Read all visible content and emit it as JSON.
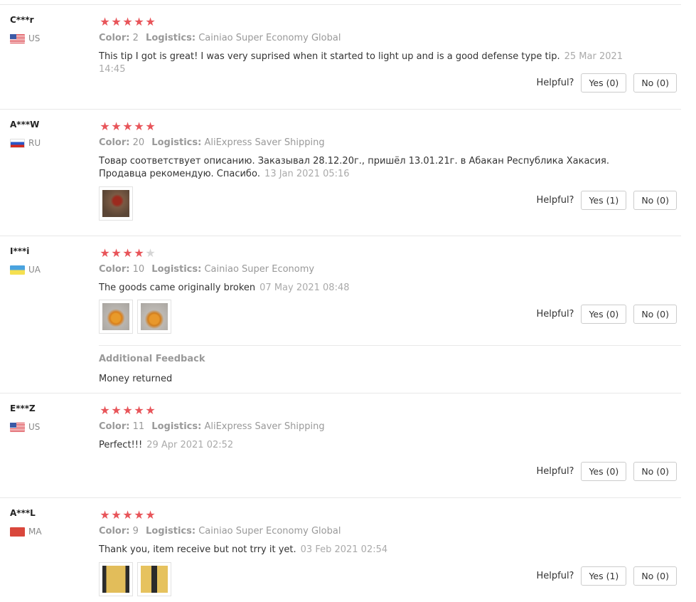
{
  "helpful_label": "Helpful?",
  "color_label": "Color:",
  "logistics_label": "Logistics:",
  "reviews": [
    {
      "user": "C***r",
      "country": "US",
      "stars": 5,
      "color": "2",
      "logistics": "Cainiao Super Economy Global",
      "text": "This tip I got is great! I was very suprised when it started to light up and is a good defense type tip.",
      "date": "25 Mar 2021 14:45",
      "yes": "Yes (0)",
      "no": "No (0)"
    },
    {
      "user": "A***W",
      "country": "RU",
      "stars": 5,
      "color": "20",
      "logistics": "AliExpress Saver Shipping",
      "text": "Товар соответствует описанию. Заказывал 28.12.20г., пришёл 13.01.21г. в Абакан Республика Хакасия. Продавца рекомендую. Спасибо.",
      "date": "13 Jan 2021 05:16",
      "yes": "Yes (1)",
      "no": "No (0)"
    },
    {
      "user": "I***i",
      "country": "UA",
      "stars": 4,
      "color": "10",
      "logistics": "Cainiao Super Economy",
      "text": "The goods came originally broken",
      "date": "07 May 2021 08:48",
      "yes": "Yes (0)",
      "no": "No (0)",
      "additional_title": "Additional Feedback",
      "additional_text": "Money returned"
    },
    {
      "user": "E***Z",
      "country": "US",
      "stars": 5,
      "color": "11",
      "logistics": "AliExpress Saver Shipping",
      "text": "Perfect!!!",
      "date": "29 Apr 2021 02:52",
      "yes": "Yes (0)",
      "no": "No (0)"
    },
    {
      "user": "A***L",
      "country": "MA",
      "stars": 5,
      "color": "9",
      "logistics": "Cainiao Super Economy Global",
      "text": "Thank you, item receive but not trry it yet.",
      "date": "03 Feb 2021 02:54",
      "yes": "Yes (1)",
      "no": "No (0)"
    }
  ],
  "colors": {
    "star_filled": "#e8555a",
    "star_empty": "#d6d6d6",
    "meta_gray": "#999999",
    "border": "#e8e8e8"
  }
}
